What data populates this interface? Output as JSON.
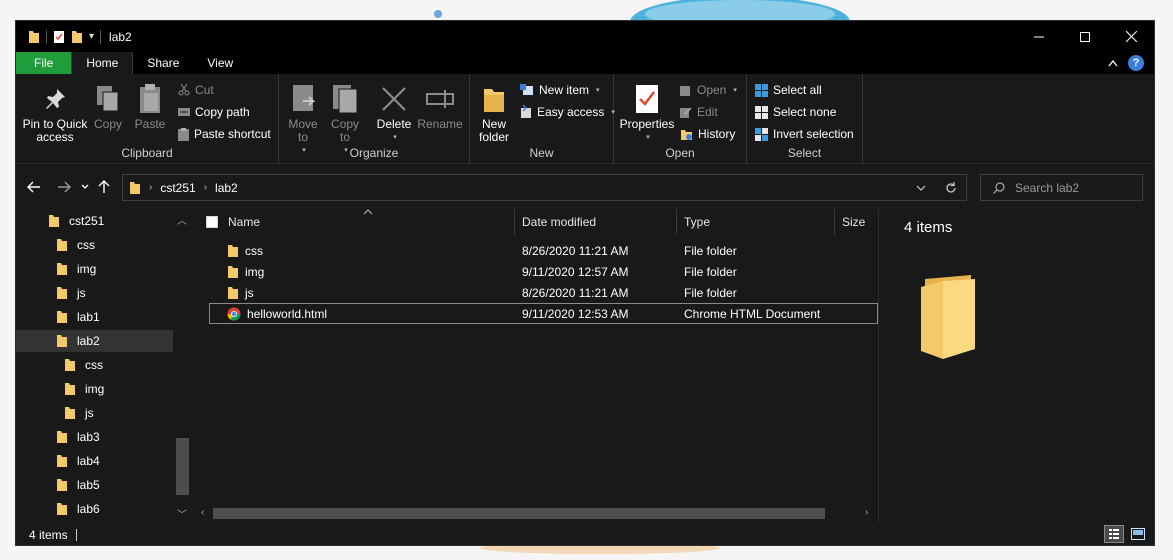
{
  "window": {
    "title": "lab2"
  },
  "tabs": [
    {
      "label": "File"
    },
    {
      "label": "Home"
    },
    {
      "label": "Share"
    },
    {
      "label": "View"
    }
  ],
  "ribbon": {
    "clipboard": {
      "pin": "Pin to Quick access",
      "copy": "Copy",
      "paste": "Paste",
      "cut": "Cut",
      "copy_path": "Copy path",
      "paste_shortcut": "Paste shortcut",
      "label": "Clipboard"
    },
    "organize": {
      "move_to": "Move to",
      "copy_to": "Copy to",
      "delete": "Delete",
      "rename": "Rename",
      "label": "Organize"
    },
    "new": {
      "new_folder": "New folder",
      "new_item": "New item",
      "easy_access": "Easy access",
      "label": "New"
    },
    "open": {
      "properties": "Properties",
      "open": "Open",
      "edit": "Edit",
      "history": "History",
      "label": "Open"
    },
    "select": {
      "select_all": "Select all",
      "select_none": "Select none",
      "invert_selection": "Invert selection",
      "label": "Select"
    }
  },
  "address": {
    "crumbs": [
      "cst251",
      "lab2"
    ]
  },
  "search": {
    "placeholder": "Search lab2"
  },
  "navpane": {
    "items": [
      {
        "label": "cst251"
      },
      {
        "label": "css"
      },
      {
        "label": "img"
      },
      {
        "label": "js"
      },
      {
        "label": "lab1"
      },
      {
        "label": "lab2"
      },
      {
        "label": "css"
      },
      {
        "label": "img"
      },
      {
        "label": "js"
      },
      {
        "label": "lab3"
      },
      {
        "label": "lab4"
      },
      {
        "label": "lab5"
      },
      {
        "label": "lab6"
      }
    ]
  },
  "filelist": {
    "columns": {
      "name": "Name",
      "date": "Date modified",
      "type": "Type",
      "size": "Size"
    },
    "rows": [
      {
        "name": "css",
        "date": "8/26/2020 11:21 AM",
        "type": "File folder",
        "icon": "folder-icon"
      },
      {
        "name": "img",
        "date": "9/11/2020 12:57 AM",
        "type": "File folder",
        "icon": "folder-icon"
      },
      {
        "name": "js",
        "date": "8/26/2020 11:21 AM",
        "type": "File folder",
        "icon": "folder-icon"
      },
      {
        "name": "helloworld.html",
        "date": "9/11/2020 12:53 AM",
        "type": "Chrome HTML Document",
        "icon": "chrome-icon"
      }
    ]
  },
  "preview": {
    "count": "4 items"
  },
  "status": {
    "count": "4 items"
  },
  "colors": {
    "file_tab": "#1e9d3a",
    "folder": "#f3c96a",
    "background": "#191919",
    "accent": "#3b7dd8"
  }
}
